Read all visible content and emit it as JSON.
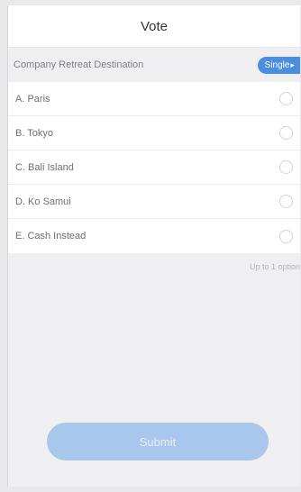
{
  "header": {
    "title": "Vote"
  },
  "question": {
    "text": "Company Retreat Destination",
    "badge": "Single",
    "badge_arrow": "▸"
  },
  "options": [
    {
      "label": "A. Paris",
      "selected": false
    },
    {
      "label": "B. Tokyo",
      "selected": false
    },
    {
      "label": "C. Bali Island",
      "selected": false
    },
    {
      "label": "D. Ko Samui",
      "selected": false
    },
    {
      "label": "E. Cash Instead",
      "selected": false
    }
  ],
  "hint": "Up to 1 option",
  "submit": {
    "label": "Submit",
    "enabled": false
  },
  "colors": {
    "accent": "#4a8ee0",
    "submit_disabled": "#a9c6ec"
  }
}
